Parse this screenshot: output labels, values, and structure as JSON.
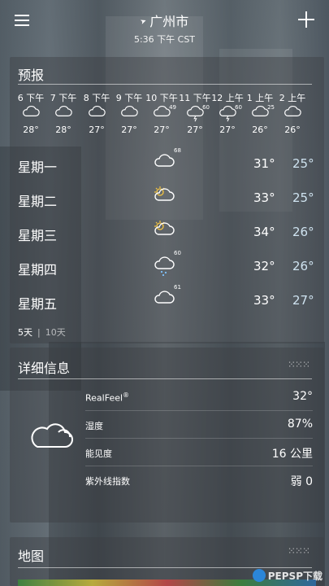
{
  "header": {
    "city": "广州市",
    "time": "5:36 下午 CST"
  },
  "forecast": {
    "title": "预报",
    "hourly": [
      {
        "label": "6 下午",
        "icon": "cloud-icon",
        "temp": "28°",
        "pct": ""
      },
      {
        "label": "7 下午",
        "icon": "cloud-icon",
        "temp": "28°",
        "pct": ""
      },
      {
        "label": "8 下午",
        "icon": "cloud-icon",
        "temp": "27°",
        "pct": ""
      },
      {
        "label": "9 下午",
        "icon": "cloud-icon",
        "temp": "27°",
        "pct": ""
      },
      {
        "label": "10 下午",
        "icon": "cloud-icon",
        "temp": "27°",
        "pct": "49"
      },
      {
        "label": "11 下午",
        "icon": "thunder-cloud-icon",
        "temp": "27°",
        "pct": "60"
      },
      {
        "label": "12 上午",
        "icon": "thunder-cloud-icon",
        "temp": "27°",
        "pct": "60"
      },
      {
        "label": "1 上午",
        "icon": "cloud-icon",
        "temp": "26°",
        "pct": "25"
      },
      {
        "label": "2 上午",
        "icon": "cloud-icon",
        "temp": "26°",
        "pct": ""
      }
    ],
    "daily": [
      {
        "day": "星期一",
        "icon": "cloud-icon",
        "pct": "68",
        "hi": "31°",
        "lo": "25°"
      },
      {
        "day": "星期二",
        "icon": "partly-sunny-icon",
        "pct": "",
        "hi": "33°",
        "lo": "25°"
      },
      {
        "day": "星期三",
        "icon": "partly-sunny-icon",
        "pct": "",
        "hi": "34°",
        "lo": "26°"
      },
      {
        "day": "星期四",
        "icon": "rain-cloud-icon",
        "pct": "60",
        "hi": "32°",
        "lo": "26°"
      },
      {
        "day": "星期五",
        "icon": "cloud-icon",
        "pct": "61",
        "hi": "33°",
        "lo": "27°"
      }
    ],
    "range_5": "5天",
    "range_10": "10天"
  },
  "details": {
    "title": "详细信息",
    "rows": [
      {
        "label": "RealFeel",
        "sup": "®",
        "value": "32°"
      },
      {
        "label": "湿度",
        "value": "87%"
      },
      {
        "label": "能见度",
        "value": "16 公里"
      },
      {
        "label": "紫外线指数",
        "value": "弱 0"
      }
    ]
  },
  "map": {
    "title": "地图"
  },
  "watermark": "PEPSP下载"
}
